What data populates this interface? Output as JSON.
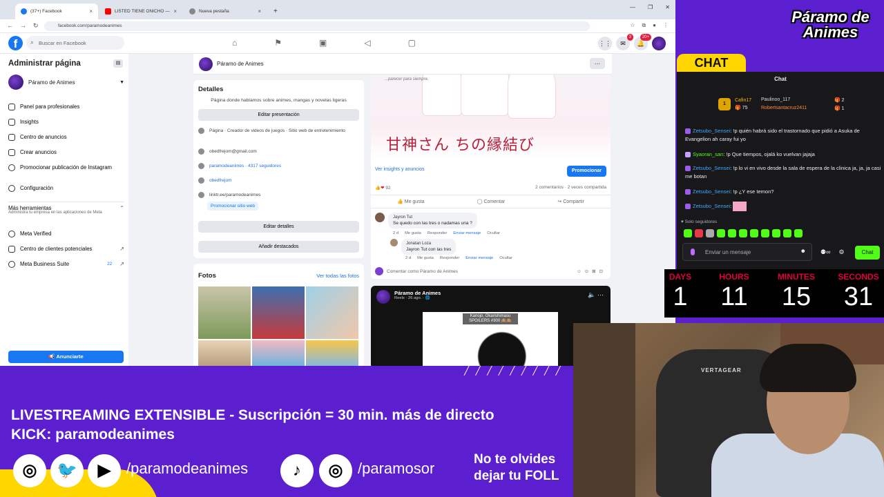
{
  "browser": {
    "tabs": [
      {
        "label": "(37+) Facebook",
        "color": "#1877f2",
        "active": true
      },
      {
        "label": "LISTED TIENE ONICHO — YouTube",
        "color": "#ff0000",
        "active": false
      },
      {
        "label": "Nueva pestaña",
        "color": "#888888",
        "active": false
      }
    ],
    "new_tab": "+",
    "url": "facebook.com/paramodeanimes"
  },
  "fb": {
    "search_placeholder": "Buscar en Facebook",
    "notif_badge": "20+",
    "messenger_badge": "3"
  },
  "left": {
    "title": "Administrar página",
    "page_name": "Páramo de Animes",
    "items": [
      {
        "label": "Panel para profesionales",
        "icon": "dashboard-icon"
      },
      {
        "label": "Insights",
        "icon": "insights-icon"
      },
      {
        "label": "Centro de anuncios",
        "icon": "ads-icon"
      },
      {
        "label": "Crear anuncios",
        "icon": "pencil-icon"
      },
      {
        "label": "Promocionar publicación de Instagram",
        "icon": "instagram-icon"
      },
      {
        "label": "Configuración",
        "icon": "gear-icon"
      }
    ],
    "more_title": "Más herramientas",
    "more_desc": "Administra tu empresa en las aplicaciones de Meta",
    "more_items": [
      {
        "label": "Meta Verified",
        "icon": "verified-icon",
        "extra": ""
      },
      {
        "label": "Centro de clientes potenciales",
        "icon": "leads-icon",
        "extra": "↗"
      },
      {
        "label": "Meta Business Suite",
        "icon": "business-icon",
        "extra": "22"
      }
    ],
    "cta": "Anunciarte"
  },
  "page_header": {
    "name": "Páramo de Animes"
  },
  "details": {
    "title": "Detalles",
    "description": "Página donde hablamos sobre animes, mangas y novelas ligeras",
    "edit_presentation": "Editar presentación",
    "rows": [
      {
        "text": "Página · Creador de videos de juegos · Sitio web de entretenimiento",
        "link": false
      },
      {
        "text": "obedfrejom@gmail.com",
        "link": false
      },
      {
        "text": "paramodeanimes · 4317 seguidores",
        "link": true
      },
      {
        "text": "obedfrejom",
        "link": true
      },
      {
        "text": "linktr.ee/paramodeanimes",
        "link": false
      }
    ],
    "promote_site": "Promocionar sitio web",
    "edit_details": "Editar detalles",
    "add_featured": "Añadir destacados"
  },
  "photos": {
    "title": "Fotos",
    "see_all": "Ver todas las fotos"
  },
  "post1": {
    "art_caption": "...parecer para siempre.",
    "art_title": "甘神さん ちの縁結び",
    "insights_link": "Ver insights y anuncios",
    "promote": "Promocionar",
    "reaction_count": "92",
    "stats": "2 comentarios · 2 veces compartida",
    "actions": [
      "Me gusta",
      "Comentar",
      "Compartir"
    ],
    "comments": [
      {
        "author": "Jayron Tut",
        "text": "Se quedo con las tres o nadamas una ?",
        "meta": [
          "2 d",
          "Me gusta",
          "Responder",
          "Enviar mensaje",
          "Ocultar"
        ]
      },
      {
        "author": "Jonatan Loza",
        "text": "Jayron Tut con las tres",
        "meta": [
          "2 d",
          "Me gusta",
          "Responder",
          "Enviar mensaje",
          "Ocultar"
        ]
      }
    ],
    "comment_placeholder": "Comentar como Páramo de Animes"
  },
  "post2": {
    "name": "Páramo de Animes",
    "sub": "Reels · 26 ago. · 🌐",
    "caption": "Kanojo, Okarishimasu SPOILERS #300 🙈🙈"
  },
  "chat": {
    "brand": "Páramo de Animes",
    "tab_label": "CHAT",
    "header": "Chat",
    "gifters": [
      {
        "name": "Cafin17",
        "count": "75"
      },
      {
        "name": "Paulinoo_117",
        "count": "2"
      },
      {
        "name": "Robertsantacruz2411",
        "count": "1"
      }
    ],
    "messages": [
      {
        "user": "Zetsubo_Sensei",
        "text": "!p quién habrá sido el trastornado que pidió a Asuka de Evangelion ah caray fui yo"
      },
      {
        "user": "Syaoran_san",
        "text": "!p Que tiempos, ojalá ko vuelvan jajaja"
      },
      {
        "user": "Zetsubo_Sensei",
        "text": "!p lo vi en vivo desde la sala de espera de la clinica ja, ja, ja casi me botan"
      },
      {
        "user": "Zetsubo_Sensei",
        "text": "!p ¿Y ese temon?"
      },
      {
        "user": "Zetsubo_Sensei",
        "text": ""
      }
    ],
    "solo": "Solo seguidores",
    "input_placeholder": "Enviar un mensaje",
    "send_label": "Chat",
    "viewer_text": "∞"
  },
  "countdown": {
    "labels": [
      "DAYS",
      "HOURS",
      "MINUTES",
      "SECONDS"
    ],
    "values": [
      "1",
      "11",
      "15",
      "31"
    ]
  },
  "webcam": {
    "chair_brand": "VERTAGEAR"
  },
  "banner": {
    "line1": "LIVESTREAMING EXTENSIBLE - Suscripción = 30 min. más de directo",
    "line2": "KICK: paramodeanimes",
    "handle1": "/paramodeanimes",
    "handle2": "/paramosor",
    "reminder1": "No te olvides",
    "reminder2": "dejar tu FOLL"
  }
}
